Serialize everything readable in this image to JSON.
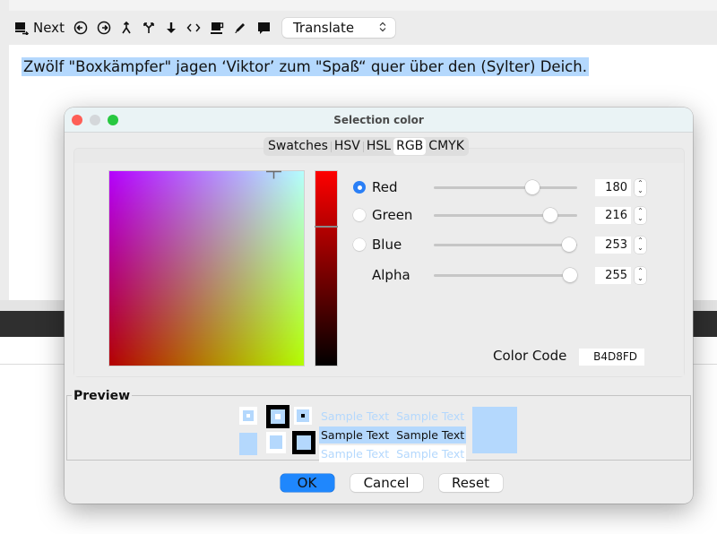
{
  "toolbar": {
    "next_label": "Next",
    "icons": [
      "next-segment-icon",
      "previous-circle-icon",
      "next-circle-icon",
      "merge-icon",
      "split-icon",
      "down-arrow-icon",
      "tags-icon",
      "coffee-icon",
      "pencil-icon",
      "comment-icon"
    ],
    "mode_select": {
      "value": "Translate",
      "arrows": "⌃⌄"
    }
  },
  "editor": {
    "sentence": "Zwölf \"Boxkämpfer\" jagen ‘Viktor’ zum \"Spaß“ quer über den (Sylter) Deich."
  },
  "dialog": {
    "title": "Selection color",
    "tabs": [
      {
        "label": "Swatches",
        "active": false
      },
      {
        "label": "HSV",
        "active": false
      },
      {
        "label": "HSL",
        "active": false
      },
      {
        "label": "RGB",
        "active": true
      },
      {
        "label": "CMYK",
        "active": false
      }
    ],
    "channels": [
      {
        "label": "Red",
        "value": "180",
        "fraction": 0.706,
        "radio": "checked"
      },
      {
        "label": "Green",
        "value": "216",
        "fraction": 0.847,
        "radio": "unchecked"
      },
      {
        "label": "Blue",
        "value": "253",
        "fraction": 0.992,
        "radio": "unchecked"
      },
      {
        "label": "Alpha",
        "value": "255",
        "fraction": 1.0,
        "radio": "none"
      }
    ],
    "color_code_label": "Color Code",
    "color_code": "B4D8FD",
    "selected_color": "#b4d8fd",
    "preview": {
      "legend": "Preview",
      "sample_text": "Sample Text",
      "rows": [
        [
          "Sample Text",
          "Sample Text"
        ],
        [
          "Sample Text",
          "Sample Text"
        ],
        [
          "Sample Text",
          "Sample Text"
        ]
      ]
    },
    "buttons": {
      "ok": "OK",
      "cancel": "Cancel",
      "reset": "Reset"
    }
  }
}
